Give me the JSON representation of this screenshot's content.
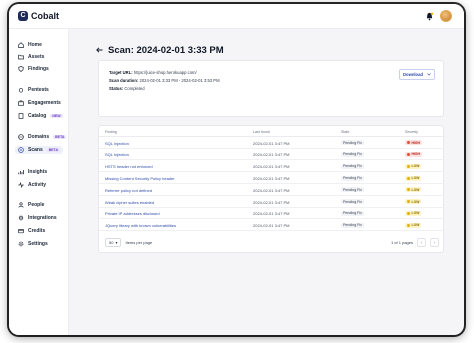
{
  "app": {
    "brand": "Cobalt",
    "logo_letter": "C"
  },
  "sidebar": {
    "items": [
      {
        "label": "Home",
        "icon": "home-icon"
      },
      {
        "label": "Assets",
        "icon": "folder-icon"
      },
      {
        "label": "Findings",
        "icon": "shield-icon"
      },
      {
        "label": "Pentests",
        "icon": "bug-icon"
      },
      {
        "label": "Engagements",
        "icon": "briefcase-icon"
      },
      {
        "label": "Catalog",
        "icon": "book-icon",
        "badge": "NEW"
      },
      {
        "label": "Domains",
        "icon": "globe-icon",
        "badge": "BETA"
      },
      {
        "label": "Scans",
        "icon": "radar-icon",
        "badge": "BETA",
        "active": true
      },
      {
        "label": "Insights",
        "icon": "chart-icon"
      },
      {
        "label": "Activity",
        "icon": "activity-icon"
      },
      {
        "label": "People",
        "icon": "people-icon"
      },
      {
        "label": "Integrations",
        "icon": "plug-icon"
      },
      {
        "label": "Credits",
        "icon": "credit-card-icon"
      },
      {
        "label": "Settings",
        "icon": "gear-icon"
      }
    ]
  },
  "page": {
    "title": "Scan: 2024-02-01 3:33 PM"
  },
  "scan_info": {
    "target_label": "Target URL:",
    "target_value": "https://juice-shop.herokuapp.com/",
    "duration_label": "Scan duration:",
    "duration_value": "2024-02-01 3:33 PM - 2024-02-01 3:53 PM",
    "status_label": "Status:",
    "status_value": "Completed",
    "download_label": "Download"
  },
  "table": {
    "headers": {
      "finding": "Finding",
      "last_found": "Last found",
      "state": "State",
      "severity": "Severity"
    },
    "rows": [
      {
        "finding": "SQL Injection",
        "last_found": "2024-02-01 3:47 PM",
        "state": "Pending Fix",
        "severity": "HIGH"
      },
      {
        "finding": "SQL Injection",
        "last_found": "2024-02-01 3:47 PM",
        "state": "Pending Fix",
        "severity": "HIGH"
      },
      {
        "finding": "HSTS header not enforced",
        "last_found": "2024-02-01 3:47 PM",
        "state": "Pending Fix",
        "severity": "LOW"
      },
      {
        "finding": "Missing Content Security Policy header",
        "last_found": "2024-02-01 3:47 PM",
        "state": "Pending Fix",
        "severity": "LOW"
      },
      {
        "finding": "Referrer policy not defined",
        "last_found": "2024-02-01 3:47 PM",
        "state": "Pending Fix",
        "severity": "LOW"
      },
      {
        "finding": "Weak cipher suites enabled",
        "last_found": "2024-02-01 3:47 PM",
        "state": "Pending Fix",
        "severity": "LOW"
      },
      {
        "finding": "Private IP addresses disclosed",
        "last_found": "2024-02-01 3:47 PM",
        "state": "Pending Fix",
        "severity": "LOW"
      },
      {
        "finding": "JQuery library with known vulnerabilities",
        "last_found": "2024-02-01 3:47 PM",
        "state": "Pending Fix",
        "severity": "LOW"
      }
    ],
    "footer": {
      "per_page_value": "50",
      "per_page_label": "Items per page",
      "pagination": "1 of 1 pages"
    }
  },
  "colors": {
    "accent": "#2e4aa8",
    "high": "#e04f3b",
    "low": "#e0b400"
  }
}
